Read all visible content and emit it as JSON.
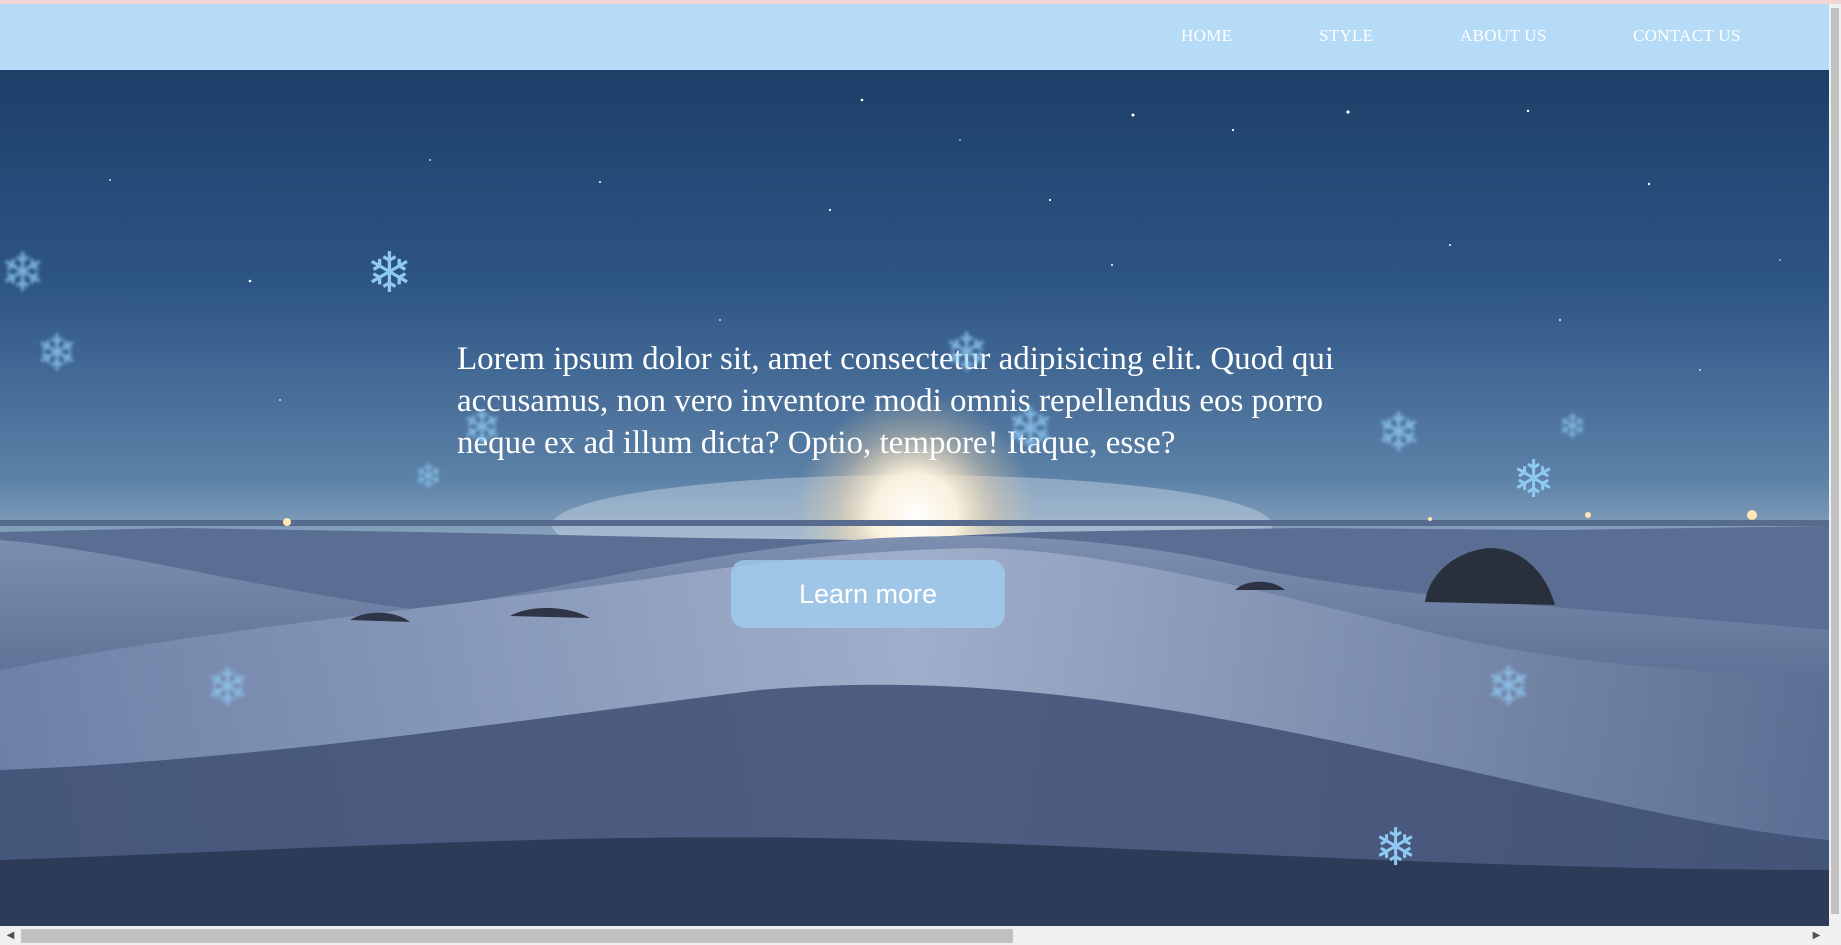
{
  "nav": {
    "links": [
      "HOME",
      "STYLE",
      "ABOUT US",
      "CONTACT US"
    ]
  },
  "hero": {
    "text": "Lorem ipsum dolor sit, amet consectetur adipisicing elit. Quod qui accusamus, non vero inventore modi omnis repellendus eos porro neque ex ad illum dicta? Optio, tempore! Itaque, esse?",
    "button_label": "Learn more"
  },
  "decor": {
    "flake_glyph": "❄",
    "flake_icon": "snowflake-icon",
    "flake_color": "#8ec9f2",
    "nav_bg": "#b6dbf6"
  },
  "scrollbar": {
    "left_arrow": "◀",
    "right_arrow": "▶"
  }
}
